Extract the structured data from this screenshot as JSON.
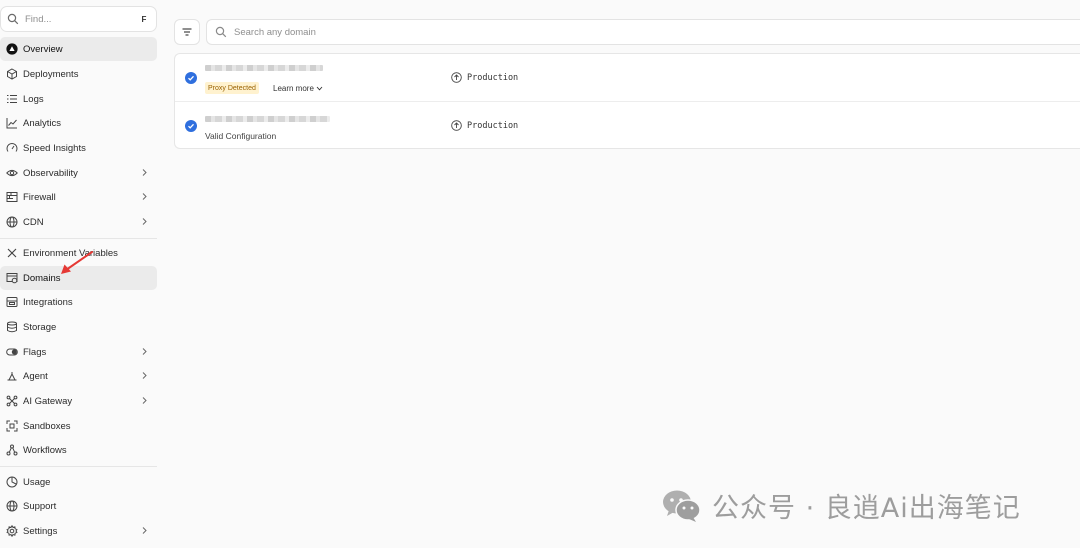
{
  "sidebar": {
    "find_placeholder": "Find...",
    "find_shortcut": "F",
    "items": [
      {
        "label": "Overview",
        "icon": "overview-triangle-icon",
        "active": true
      },
      {
        "label": "Deployments",
        "icon": "cube-icon"
      },
      {
        "label": "Logs",
        "icon": "list-icon"
      },
      {
        "label": "Analytics",
        "icon": "chart-line-icon"
      },
      {
        "label": "Speed Insights",
        "icon": "gauge-icon"
      },
      {
        "label": "Observability",
        "icon": "eye-icon",
        "chevron": true
      },
      {
        "label": "Firewall",
        "icon": "firewall-icon",
        "chevron": true
      },
      {
        "label": "CDN",
        "icon": "globe-icon",
        "chevron": true
      },
      {
        "label": "Environment Variables",
        "icon": "variables-icon"
      },
      {
        "label": "Domains",
        "icon": "domain-icon",
        "active": true
      },
      {
        "label": "Integrations",
        "icon": "integrations-icon"
      },
      {
        "label": "Storage",
        "icon": "database-icon"
      },
      {
        "label": "Flags",
        "icon": "toggle-icon",
        "chevron": true
      },
      {
        "label": "Agent",
        "icon": "sparkle-icon",
        "chevron": true
      },
      {
        "label": "AI Gateway",
        "icon": "gateway-icon",
        "chevron": true
      },
      {
        "label": "Sandboxes",
        "icon": "sandbox-icon"
      },
      {
        "label": "Workflows",
        "icon": "workflow-icon"
      },
      {
        "label": "Usage",
        "icon": "pie-clock-icon"
      },
      {
        "label": "Support",
        "icon": "support-globe-icon"
      },
      {
        "label": "Settings",
        "icon": "gear-icon",
        "chevron": true
      }
    ]
  },
  "toolbar": {
    "search_placeholder": "Search any domain",
    "filter_icon": "filter-icon"
  },
  "domains": [
    {
      "badge": "Proxy Detected",
      "learn_more": "Learn more",
      "environment": "Production"
    },
    {
      "status": "Valid Configuration",
      "environment": "Production"
    }
  ],
  "watermark": {
    "text": "公众号 · 良逍Ai出海笔记"
  },
  "colors": {
    "accent": "#2f6fde",
    "badge_bg": "#fff2cf",
    "badge_text": "#9a6200",
    "annotation": "#e53935"
  }
}
